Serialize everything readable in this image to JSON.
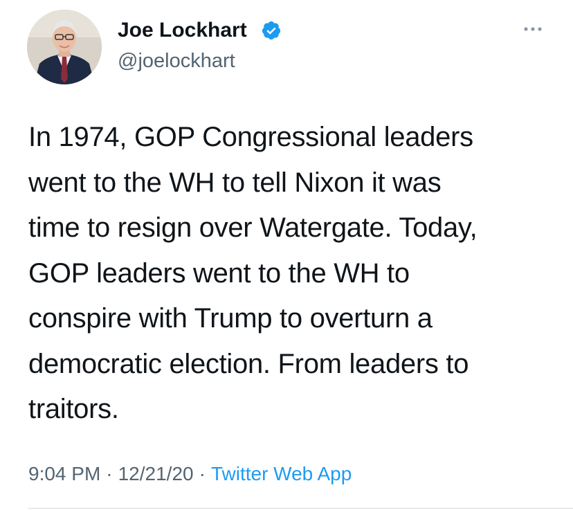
{
  "author": {
    "display_name": "Joe Lockhart",
    "handle": "@joelockhart",
    "verified": true,
    "avatar_icon": "profile-photo"
  },
  "header": {
    "more_icon": "more-dots-icon"
  },
  "tweet": {
    "text": "In 1974, GOP Congressional leaders\nwent to the WH to tell Nixon it was\ntime to resign over Watergate. Today,\nGOP leaders went to the WH to\nconspire with Trump to overturn  a\ndemocratic election.  From leaders to\ntraitors."
  },
  "meta": {
    "time": "9:04 PM",
    "separator": "·",
    "date": "12/21/20",
    "source": "Twitter Web App"
  },
  "colors": {
    "text": "#0f1419",
    "secondary": "#536471",
    "accent": "#1d9bf0",
    "divider": "#cfd9de"
  }
}
